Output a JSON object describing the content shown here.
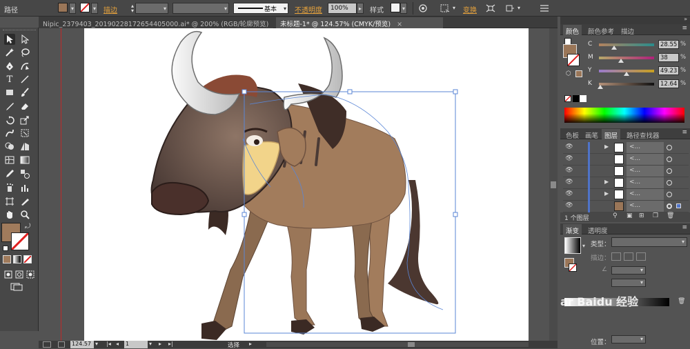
{
  "control_bar": {
    "path_label": "路径",
    "fill_color": "#9a7658",
    "stroke_label": "描边",
    "stroke_style_label": "基本",
    "opacity_label": "不透明度",
    "opacity_value": "100%",
    "style_label": "样式",
    "transform_label": "变换"
  },
  "tabs": [
    {
      "label": "Nipic_2379403_20190228172654405000.ai* @ 200% (RGB/轮廓预览)",
      "close": "×"
    },
    {
      "label": "未标题-1* @ 124.57% (CMYK/预览)",
      "close": "×"
    }
  ],
  "toolbar": {
    "fill_color": "#a07b5c",
    "stroke_color": "none",
    "tools": [
      "selection-tool",
      "direct-selection-tool",
      "magic-wand-tool",
      "lasso-tool",
      "pen-tool",
      "curvature-tool",
      "type-tool",
      "line-tool",
      "rectangle-tool",
      "paintbrush-tool",
      "pencil-tool",
      "eraser-tool",
      "rotate-tool",
      "scale-tool",
      "warp-tool",
      "free-transform-tool",
      "shape-builder-tool",
      "perspective-grid-tool",
      "mesh-tool",
      "gradient-tool",
      "eyedropper-tool",
      "blend-tool",
      "symbol-sprayer-tool",
      "column-graph-tool",
      "artboard-tool",
      "slice-tool",
      "hand-tool",
      "zoom-tool"
    ]
  },
  "status": {
    "zoom": "124.57",
    "page": "1",
    "mode": "选择"
  },
  "color_panel": {
    "tabs": [
      "颜色",
      "颜色参考",
      "描边"
    ],
    "channels": [
      {
        "label": "C",
        "value": "28.55",
        "unit": "%"
      },
      {
        "label": "M",
        "value": "38",
        "unit": "%"
      },
      {
        "label": "Y",
        "value": "49.23",
        "unit": "%"
      },
      {
        "label": "K",
        "value": "12.64",
        "unit": "%"
      }
    ],
    "current_color": "#9a7658"
  },
  "layers_panel": {
    "tabs": [
      "色板",
      "画笔",
      "图层",
      "路径查找器"
    ],
    "rows": [
      {
        "name": "<..."
      },
      {
        "name": "<..."
      },
      {
        "name": "<..."
      },
      {
        "name": "<..."
      },
      {
        "name": "<..."
      },
      {
        "name": "<..."
      }
    ],
    "count_label": "1 个图层"
  },
  "gradient_panel": {
    "tabs": [
      "渐变",
      "透明度"
    ],
    "type_label": "类型：",
    "stroke_label": "描边：",
    "position_label": "位置："
  },
  "watermark": "ar Baidu 经验"
}
